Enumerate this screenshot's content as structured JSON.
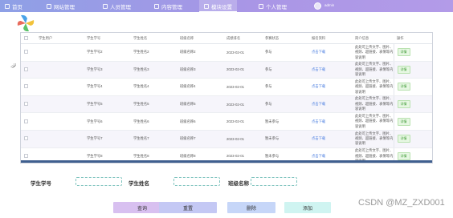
{
  "nav": {
    "items": [
      {
        "label": "首页"
      },
      {
        "label": "网站管理"
      },
      {
        "label": "人员管理"
      },
      {
        "label": "内容管理"
      },
      {
        "label": "模块设置"
      },
      {
        "label": "个人管理"
      }
    ],
    "active_index": 4,
    "user": "admin"
  },
  "table": {
    "columns": [
      "学生用户",
      "学生学号",
      "学生姓名",
      "班级名称",
      "成绩排名",
      "参赛状态",
      "报名资料",
      "简介信息",
      "操作"
    ],
    "rows": [
      {
        "no": "学生学号2",
        "name": "学生姓名2",
        "cls": "班级名称2",
        "date": "2023-02-01",
        "status": "参与",
        "file": "点击下载",
        "intro": "此处可上传文字、图片、视频、超链接、表情等内容说明",
        "op": "详情"
      },
      {
        "no": "学生学号3",
        "name": "学生姓名3",
        "cls": "班级名称3",
        "date": "2023-02-01",
        "status": "参与",
        "file": "点击下载",
        "intro": "此处可上传文字、图片、视频、超链接、表情等内容说明",
        "op": "详情"
      },
      {
        "no": "学生学号4",
        "name": "学生姓名4",
        "cls": "班级名称4",
        "date": "2023-02-01",
        "status": "参与",
        "file": "点击下载",
        "intro": "此处可上传文字、图片、视频、超链接、表情等内容说明",
        "op": "详情"
      },
      {
        "no": "学生学号5",
        "name": "学生姓名5",
        "cls": "班级名称5",
        "date": "2023-02-01",
        "status": "参与",
        "file": "点击下载",
        "intro": "此处可上传文字、图片、视频、超链接、表情等内容说明",
        "op": "详情"
      },
      {
        "no": "学生学号6",
        "name": "学生姓名6",
        "cls": "班级名称6",
        "date": "2023-02-01",
        "status": "暂未参与",
        "file": "点击下载",
        "intro": "此处可上传文字、图片、视频、超链接、表情等内容说明",
        "op": "详情"
      },
      {
        "no": "学生学号7",
        "name": "学生姓名7",
        "cls": "班级名称7",
        "date": "2023-02-01",
        "status": "暂未参与",
        "file": "点击下载",
        "intro": "此处可上传文字、图片、视频、超链接、表情等内容说明",
        "op": "详情"
      },
      {
        "no": "学生学号8",
        "name": "学生姓名8",
        "cls": "班级名称8",
        "date": "2023-02-01",
        "status": "暂未参与",
        "file": "点击下载",
        "intro": "此处可上传文字、图片、视频、超链接、表情等内容说明",
        "op": "详情"
      }
    ]
  },
  "search": {
    "no_label": "学生学号",
    "name_label": "学生姓名",
    "cls_label": "班级名称"
  },
  "actions": {
    "query": "查询",
    "reset": "重置",
    "delete": "删除",
    "add": "添加"
  },
  "watermark": "CSDN @MZ_ZXD001",
  "colors": {
    "nav_start": "#8ea0e6",
    "nav_end": "#b39be8",
    "link": "#4a7de0",
    "detail_button": "#3e9a36"
  },
  "icons": [
    "pinwheel-logo",
    "nav-icon",
    "avatar",
    "cursor-icon"
  ]
}
